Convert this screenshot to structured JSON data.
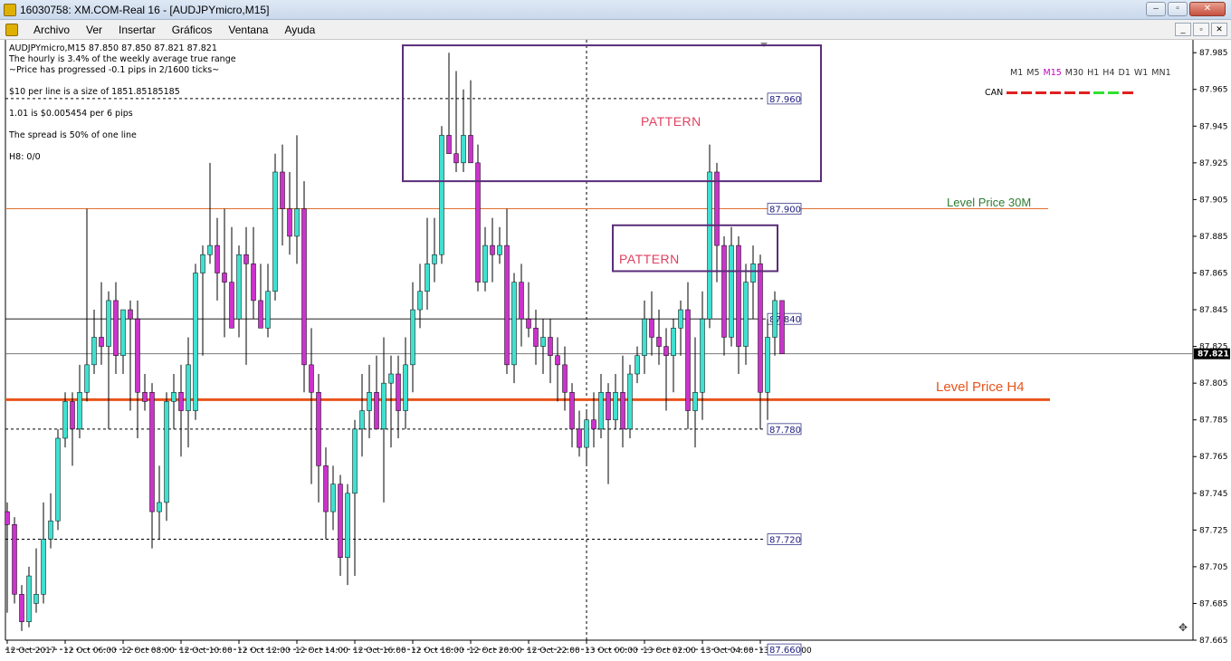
{
  "window": {
    "title": "16030758: XM.COM-Real 16 - [AUDJPYmicro,M15]",
    "controls": [
      "–",
      "▫",
      "✕"
    ]
  },
  "menu": {
    "items": [
      "Archivo",
      "Ver",
      "Insertar",
      "Gráficos",
      "Ventana",
      "Ayuda"
    ],
    "mdi_controls": [
      "_",
      "▫",
      "✕"
    ]
  },
  "info": {
    "header": "AUDJPYmicro,M15  87.850 87.850 87.821 87.821",
    "line1": "The hourly is 3.4% of the weekly average true range",
    "line2": "~Price has progressed  -0.1  pips in 2/1600 ticks~",
    "line3": "$10 per line is a size of 1851.85185185",
    "line4": "1.01 is $0.005454 per 6 pips",
    "line5": "The spread is 50% of one line",
    "line6": "H8: 0/0"
  },
  "annotations": {
    "pattern1": "PATTERN",
    "pattern2": "PATTERN",
    "level30m": "Level Price 30M",
    "levelh4": "Level Price H4"
  },
  "timeframes": {
    "items": [
      "M1",
      "M5",
      "M15",
      "M30",
      "H1",
      "H4",
      "D1",
      "W1",
      "MN1"
    ],
    "active": "M15",
    "can_label": "CAN",
    "can_colors": [
      "#e02020",
      "#e02020",
      "#e02020",
      "#e02020",
      "#e02020",
      "#e02020",
      "#30e030",
      "#30e030",
      "#e02020"
    ]
  },
  "colors": {
    "bull": "#40e0d0",
    "bear": "#cc33cc",
    "wick": "#000000",
    "level_h4": "#e8541c",
    "level_30m": "#e07030",
    "level_30m_text": "#2e7d32",
    "pattern_box": "#5a2d7a",
    "pattern_text": "#e0405e"
  },
  "chart_data": {
    "type": "candlestick",
    "symbol": "AUDJPYmicro",
    "timeframe": "M15",
    "ylim": [
      87.665,
      87.992
    ],
    "y_ticks": [
      "87.985",
      "87.965",
      "87.945",
      "87.925",
      "87.905",
      "87.885",
      "87.865",
      "87.845",
      "87.825",
      "87.805",
      "87.785",
      "87.765",
      "87.745",
      "87.725",
      "87.705",
      "87.685",
      "87.665"
    ],
    "current_price": "87.821",
    "x_labels": [
      "12 Oct 2017",
      "12 Oct 06:00",
      "12 Oct 08:00",
      "12 Oct 10:00",
      "12 Oct 12:00",
      "12 Oct 14:00",
      "12 Oct 16:00",
      "12 Oct 18:00",
      "12 Oct 20:00",
      "12 Oct 22:00",
      "13 Oct 00:00",
      "13 Oct 02:00",
      "13 Oct 04:00",
      "13 Oct 06:00"
    ],
    "levels": [
      {
        "price": 87.96,
        "label": "87.960",
        "style": "dashed"
      },
      {
        "price": 87.9,
        "label": "87.900",
        "style": "solid_orange"
      },
      {
        "price": 87.84,
        "label": "87.840",
        "style": "solid"
      },
      {
        "price": 87.78,
        "label": "87.780",
        "style": "dashed"
      },
      {
        "price": 87.72,
        "label": "87.720",
        "style": "dashed"
      },
      {
        "price": 87.66,
        "label": "87.660",
        "style": "dashed"
      },
      {
        "price": 87.821,
        "label": "",
        "style": "current"
      },
      {
        "price": 87.796,
        "label": "",
        "style": "h4"
      }
    ],
    "patterns": [
      {
        "start": 55,
        "end": 112,
        "low": 87.915,
        "high": 87.989
      },
      {
        "start": 84,
        "end": 106,
        "low": 87.866,
        "high": 87.891
      }
    ],
    "vline_index": 80,
    "candles": [
      [
        87.735,
        87.74,
        87.68,
        87.728
      ],
      [
        87.728,
        87.732,
        87.685,
        87.69
      ],
      [
        87.69,
        87.695,
        87.67,
        87.675
      ],
      [
        87.675,
        87.705,
        87.672,
        87.7
      ],
      [
        87.685,
        87.715,
        87.68,
        87.69
      ],
      [
        87.69,
        87.74,
        87.685,
        87.72
      ],
      [
        87.72,
        87.745,
        87.715,
        87.73
      ],
      [
        87.73,
        87.78,
        87.725,
        87.775
      ],
      [
        87.775,
        87.8,
        87.77,
        87.795
      ],
      [
        87.795,
        87.8,
        87.76,
        87.78
      ],
      [
        87.78,
        87.815,
        87.775,
        87.8
      ],
      [
        87.8,
        87.9,
        87.795,
        87.815
      ],
      [
        87.815,
        87.845,
        87.81,
        87.83
      ],
      [
        87.83,
        87.86,
        87.815,
        87.825
      ],
      [
        87.825,
        87.855,
        87.78,
        87.85
      ],
      [
        87.85,
        87.86,
        87.81,
        87.82
      ],
      [
        87.82,
        87.84,
        87.81,
        87.845
      ],
      [
        87.845,
        87.85,
        87.79,
        87.84
      ],
      [
        87.84,
        87.85,
        87.775,
        87.8
      ],
      [
        87.8,
        87.81,
        87.79,
        87.795
      ],
      [
        87.8,
        87.805,
        87.715,
        87.735
      ],
      [
        87.735,
        87.76,
        87.72,
        87.74
      ],
      [
        87.74,
        87.8,
        87.73,
        87.795
      ],
      [
        87.795,
        87.81,
        87.78,
        87.8
      ],
      [
        87.8,
        87.815,
        87.765,
        87.79
      ],
      [
        87.79,
        87.83,
        87.77,
        87.815
      ],
      [
        87.79,
        87.87,
        87.785,
        87.865
      ],
      [
        87.865,
        87.88,
        87.82,
        87.875
      ],
      [
        87.875,
        87.925,
        87.87,
        87.88
      ],
      [
        87.88,
        87.895,
        87.85,
        87.865
      ],
      [
        87.865,
        87.9,
        87.83,
        87.86
      ],
      [
        87.86,
        87.89,
        87.835,
        87.835
      ],
      [
        87.84,
        87.88,
        87.83,
        87.875
      ],
      [
        87.875,
        87.89,
        87.815,
        87.87
      ],
      [
        87.87,
        87.89,
        87.84,
        87.85
      ],
      [
        87.85,
        87.87,
        87.835,
        87.835
      ],
      [
        87.835,
        87.87,
        87.83,
        87.855
      ],
      [
        87.855,
        87.93,
        87.85,
        87.92
      ],
      [
        87.92,
        87.935,
        87.88,
        87.9
      ],
      [
        87.9,
        87.92,
        87.875,
        87.885
      ],
      [
        87.885,
        87.94,
        87.87,
        87.9
      ],
      [
        87.9,
        87.915,
        87.8,
        87.815
      ],
      [
        87.815,
        87.835,
        87.75,
        87.8
      ],
      [
        87.8,
        87.81,
        87.74,
        87.76
      ],
      [
        87.76,
        87.77,
        87.72,
        87.735
      ],
      [
        87.735,
        87.76,
        87.725,
        87.75
      ],
      [
        87.75,
        87.755,
        87.7,
        87.71
      ],
      [
        87.71,
        87.75,
        87.695,
        87.745
      ],
      [
        87.745,
        87.785,
        87.7,
        87.78
      ],
      [
        87.78,
        87.81,
        87.765,
        87.79
      ],
      [
        87.79,
        87.815,
        87.775,
        87.8
      ],
      [
        87.8,
        87.82,
        87.78,
        87.78
      ],
      [
        87.78,
        87.83,
        87.74,
        87.805
      ],
      [
        87.805,
        87.82,
        87.77,
        87.81
      ],
      [
        87.81,
        87.82,
        87.775,
        87.79
      ],
      [
        87.79,
        87.83,
        87.78,
        87.815
      ],
      [
        87.815,
        87.86,
        87.8,
        87.845
      ],
      [
        87.845,
        87.87,
        87.835,
        87.855
      ],
      [
        87.855,
        87.895,
        87.845,
        87.87
      ],
      [
        87.87,
        87.895,
        87.86,
        87.875
      ],
      [
        87.875,
        87.945,
        87.87,
        87.94
      ],
      [
        87.94,
        87.985,
        87.93,
        87.93
      ],
      [
        87.93,
        87.975,
        87.92,
        87.925
      ],
      [
        87.925,
        87.965,
        87.92,
        87.94
      ],
      [
        87.94,
        87.97,
        87.925,
        87.925
      ],
      [
        87.925,
        87.935,
        87.855,
        87.86
      ],
      [
        87.86,
        87.89,
        87.855,
        87.88
      ],
      [
        87.88,
        87.895,
        87.86,
        87.875
      ],
      [
        87.875,
        87.89,
        87.87,
        87.88
      ],
      [
        87.88,
        87.9,
        87.81,
        87.815
      ],
      [
        87.815,
        87.865,
        87.805,
        87.86
      ],
      [
        87.86,
        87.87,
        87.825,
        87.84
      ],
      [
        87.84,
        87.86,
        87.83,
        87.835
      ],
      [
        87.835,
        87.845,
        87.815,
        87.825
      ],
      [
        87.825,
        87.84,
        87.81,
        87.83
      ],
      [
        87.83,
        87.84,
        87.805,
        87.82
      ],
      [
        87.82,
        87.83,
        87.795,
        87.815
      ],
      [
        87.815,
        87.825,
        87.79,
        87.8
      ],
      [
        87.8,
        87.805,
        87.77,
        87.78
      ],
      [
        87.78,
        87.79,
        87.765,
        87.77
      ],
      [
        87.77,
        87.79,
        87.76,
        87.785
      ],
      [
        87.785,
        87.8,
        87.77,
        87.78
      ],
      [
        87.78,
        87.81,
        87.775,
        87.8
      ],
      [
        87.8,
        87.805,
        87.75,
        87.785
      ],
      [
        87.785,
        87.81,
        87.78,
        87.8
      ],
      [
        87.8,
        87.82,
        87.77,
        87.78
      ],
      [
        87.78,
        87.815,
        87.775,
        87.81
      ],
      [
        87.81,
        87.825,
        87.805,
        87.82
      ],
      [
        87.82,
        87.85,
        87.81,
        87.84
      ],
      [
        87.84,
        87.855,
        87.82,
        87.83
      ],
      [
        87.83,
        87.845,
        87.815,
        87.825
      ],
      [
        87.825,
        87.835,
        87.79,
        87.82
      ],
      [
        87.82,
        87.84,
        87.8,
        87.835
      ],
      [
        87.835,
        87.85,
        87.82,
        87.845
      ],
      [
        87.845,
        87.86,
        87.78,
        87.79
      ],
      [
        87.79,
        87.83,
        87.77,
        87.8
      ],
      [
        87.8,
        87.855,
        87.785,
        87.84
      ],
      [
        87.84,
        87.935,
        87.835,
        87.92
      ],
      [
        87.92,
        87.925,
        87.86,
        87.88
      ],
      [
        87.88,
        87.885,
        87.82,
        87.83
      ],
      [
        87.83,
        87.89,
        87.825,
        87.88
      ],
      [
        87.88,
        87.885,
        87.81,
        87.825
      ],
      [
        87.825,
        87.87,
        87.815,
        87.86
      ],
      [
        87.86,
        87.88,
        87.84,
        87.87
      ],
      [
        87.87,
        87.875,
        87.78,
        87.8
      ],
      [
        87.8,
        87.84,
        87.785,
        87.83
      ],
      [
        87.83,
        87.855,
        87.82,
        87.85
      ],
      [
        87.85,
        87.85,
        87.821,
        87.821
      ]
    ]
  }
}
